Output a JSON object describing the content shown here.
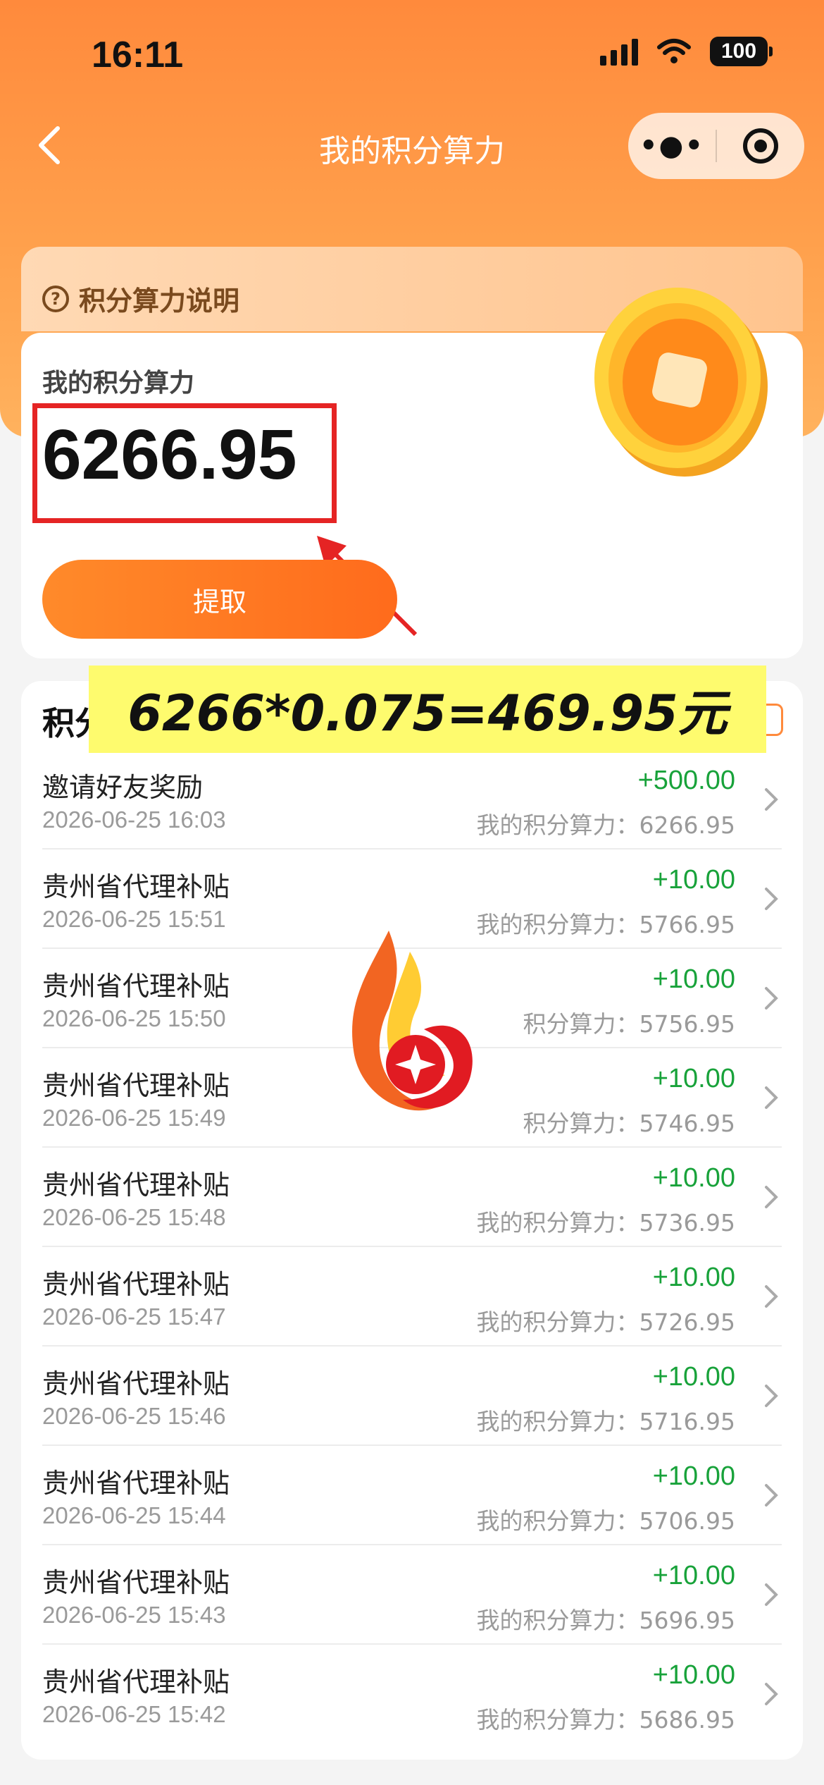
{
  "status_bar": {
    "time": "16:11",
    "battery": "100"
  },
  "nav": {
    "title": "我的积分算力"
  },
  "hint": {
    "label": "积分算力说明"
  },
  "balance": {
    "label": "我的积分算力",
    "value": "6266.95",
    "button": "提取"
  },
  "overlay": {
    "text": "6266*0.075=469.95元"
  },
  "list": {
    "header": "积分",
    "rows": [
      {
        "title": "邀请好友奖励",
        "time": "2026-06-25 16:03",
        "amount": "+500.00",
        "balance": "我的积分算力：6266.95"
      },
      {
        "title": "贵州省代理补贴",
        "time": "2026-06-25 15:51",
        "amount": "+10.00",
        "balance": "我的积分算力：5766.95"
      },
      {
        "title": "贵州省代理补贴",
        "time": "2026-06-25 15:50",
        "amount": "+10.00",
        "balance": "积分算力：5756.95"
      },
      {
        "title": "贵州省代理补贴",
        "time": "2026-06-25 15:49",
        "amount": "+10.00",
        "balance": "积分算力：5746.95"
      },
      {
        "title": "贵州省代理补贴",
        "time": "2026-06-25 15:48",
        "amount": "+10.00",
        "balance": "我的积分算力：5736.95"
      },
      {
        "title": "贵州省代理补贴",
        "time": "2026-06-25 15:47",
        "amount": "+10.00",
        "balance": "我的积分算力：5726.95"
      },
      {
        "title": "贵州省代理补贴",
        "time": "2026-06-25 15:46",
        "amount": "+10.00",
        "balance": "我的积分算力：5716.95"
      },
      {
        "title": "贵州省代理补贴",
        "time": "2026-06-25 15:44",
        "amount": "+10.00",
        "balance": "我的积分算力：5706.95"
      },
      {
        "title": "贵州省代理补贴",
        "time": "2026-06-25 15:43",
        "amount": "+10.00",
        "balance": "我的积分算力：5696.95"
      },
      {
        "title": "贵州省代理补贴",
        "time": "2026-06-25 15:42",
        "amount": "+10.00",
        "balance": "我的积分算力：5686.95"
      }
    ]
  },
  "icons": {
    "back": "chevron-left-icon",
    "more": "more-dots-icon",
    "target": "target-icon",
    "help": "question-circle-icon",
    "coin": "coin-icon",
    "chevron": "chevron-right-icon",
    "watermark": "flame-logo-icon"
  },
  "colors": {
    "accent": "#ff7a2a",
    "positive": "#18a23a",
    "highlight": "#e52424",
    "banner": "#fefb6e"
  }
}
